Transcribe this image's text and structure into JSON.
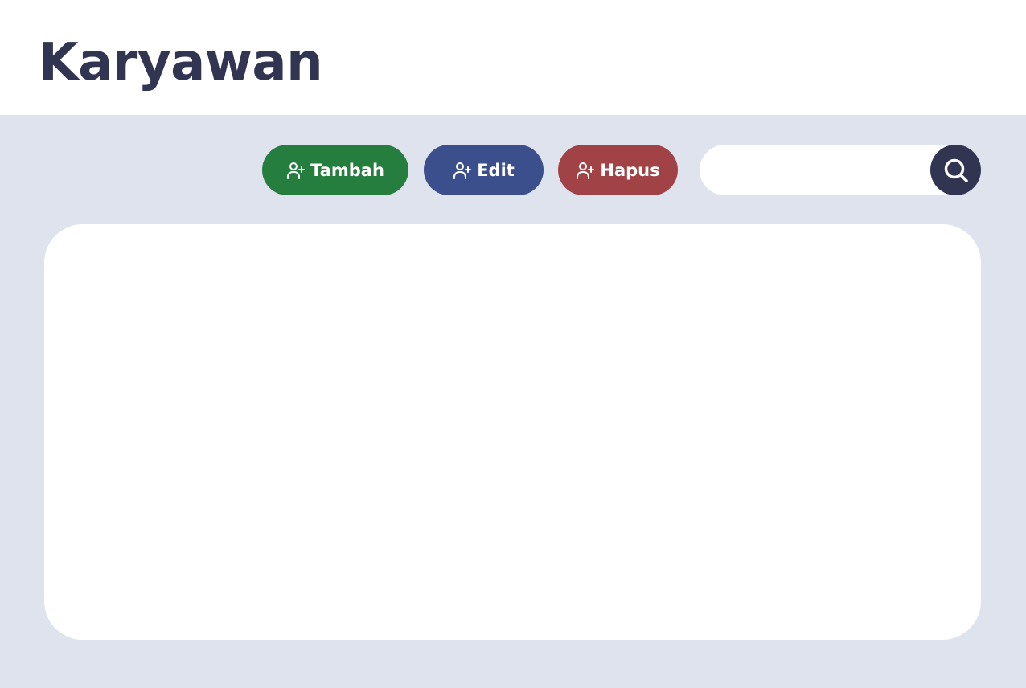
{
  "header": {
    "title": "Karyawan"
  },
  "toolbar": {
    "add_label": "Tambah",
    "edit_label": "Edit",
    "delete_label": "Hapus",
    "add_icon": "user-plus-icon",
    "edit_icon": "user-plus-icon",
    "delete_icon": "user-plus-icon"
  },
  "search": {
    "value": "",
    "placeholder": "",
    "icon": "search-icon"
  },
  "colors": {
    "title": "#323552",
    "background": "#dfe3ee",
    "add_button": "#257d3e",
    "edit_button": "#3a4f8b",
    "delete_button": "#a14346",
    "search_button": "#323552"
  }
}
